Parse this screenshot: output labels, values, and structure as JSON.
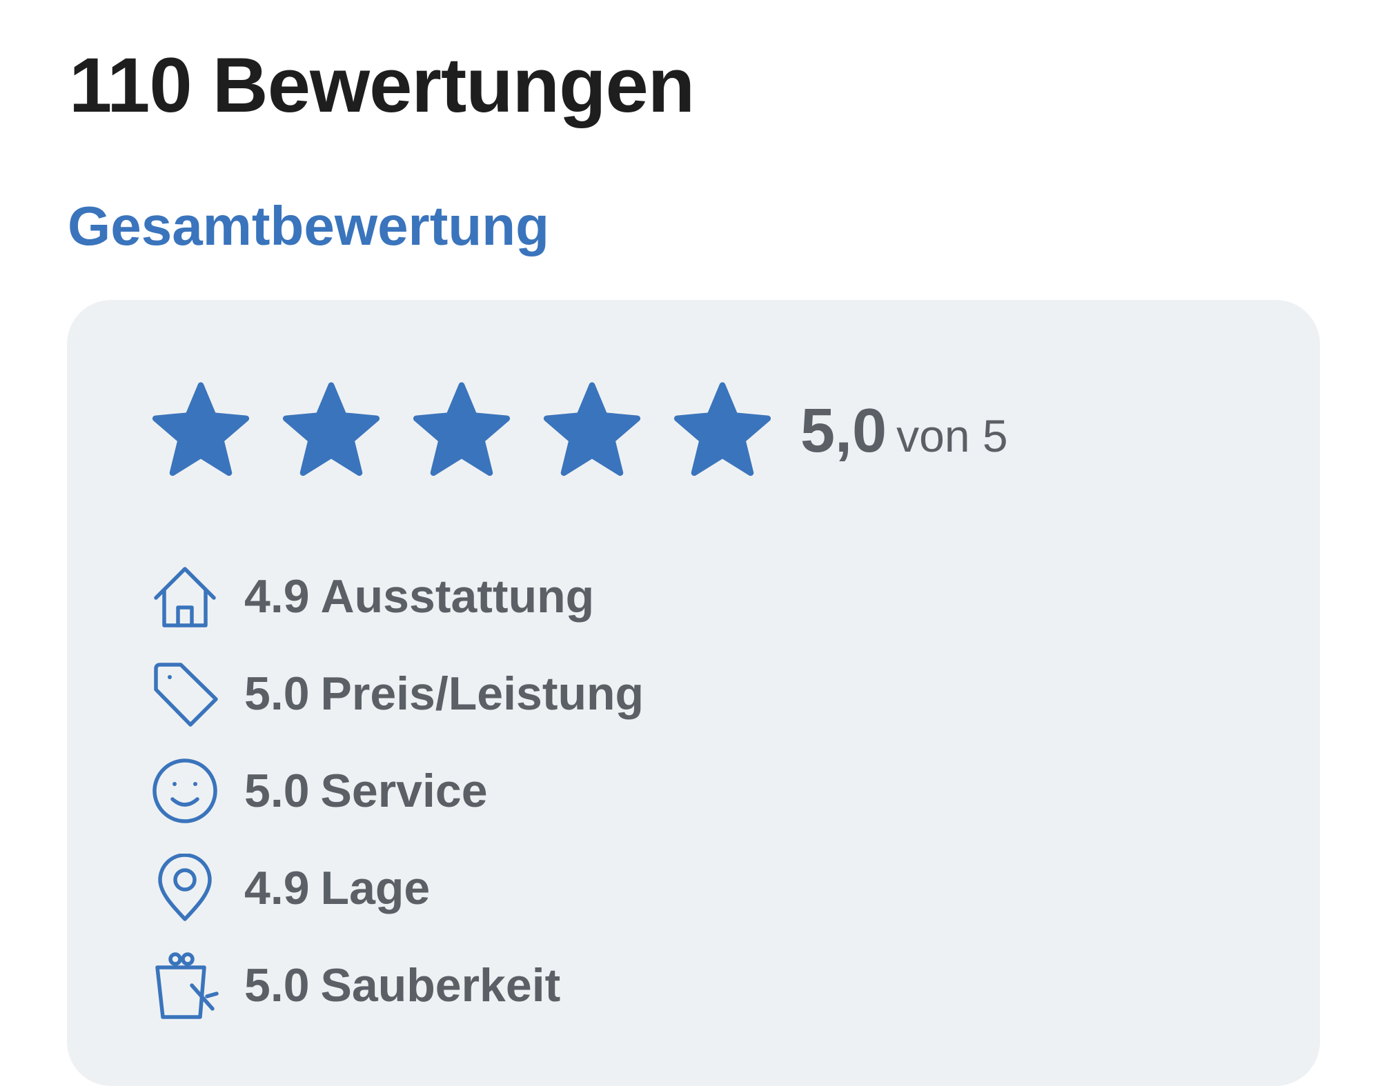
{
  "header": {
    "title": "110 Bewertungen"
  },
  "overall": {
    "section_title": "Gesamtbewertung",
    "rating": 5,
    "max_rating": 5,
    "score_text": "5,0",
    "score_suffix": "von 5",
    "star_color": "#3a74bc"
  },
  "criteria": [
    {
      "icon": "home-icon",
      "value": "4.9",
      "label": "Ausstattung"
    },
    {
      "icon": "tag-icon",
      "value": "5.0",
      "label": "Preis/Leistung"
    },
    {
      "icon": "smiley-icon",
      "value": "5.0",
      "label": "Service"
    },
    {
      "icon": "location-pin-icon",
      "value": "4.9",
      "label": "Lage"
    },
    {
      "icon": "cleaning-bucket-icon",
      "value": "5.0",
      "label": "Sauberkeit"
    }
  ],
  "colors": {
    "accent": "#3a74bc",
    "card_background": "#eef1f3",
    "title_text": "#1e1e1e",
    "muted_text": "#5b6066"
  }
}
